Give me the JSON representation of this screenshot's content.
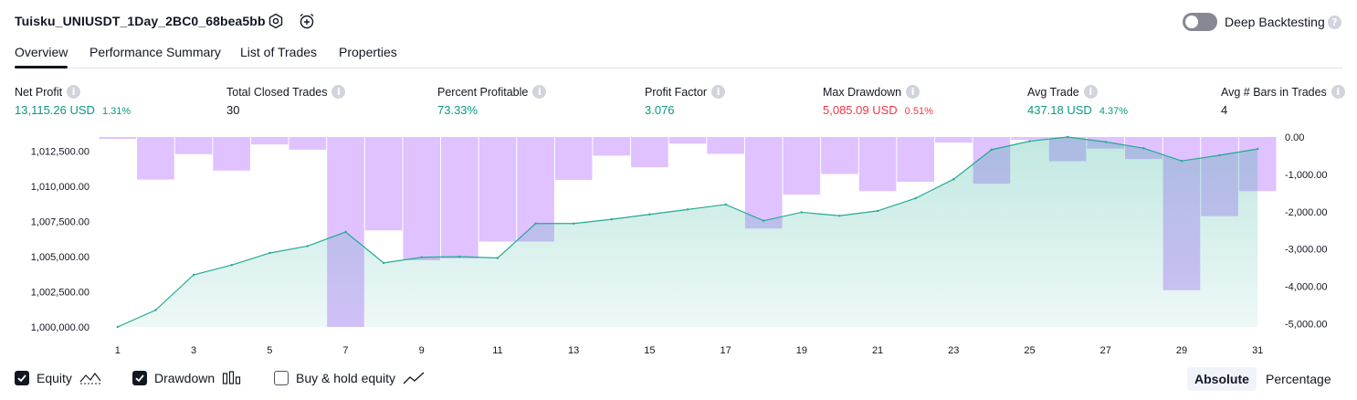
{
  "header": {
    "strategy_title": "Tuisku_UNIUSDT_1Day_2BC0_68bea5bb",
    "settings_icon": "gear-icon",
    "alert_icon": "alarm-clock-plus-icon",
    "deep_backtesting_label": "Deep Backtesting",
    "deep_backtesting_enabled": false
  },
  "tabs": [
    {
      "label": "Overview",
      "active": true
    },
    {
      "label": "Performance Summary",
      "active": false
    },
    {
      "label": "List of Trades",
      "active": false
    },
    {
      "label": "Properties",
      "active": false
    }
  ],
  "metrics": [
    {
      "label": "Net Profit",
      "value": "13,115.26 USD",
      "pct": "1.31%",
      "color": "#089981"
    },
    {
      "label": "Total Closed Trades",
      "value": "30",
      "pct": "",
      "color": "#131722"
    },
    {
      "label": "Percent Profitable",
      "value": "73.33%",
      "pct": "",
      "color": "#089981"
    },
    {
      "label": "Profit Factor",
      "value": "3.076",
      "pct": "",
      "color": "#089981"
    },
    {
      "label": "Max Drawdown",
      "value": "5,085.09 USD",
      "pct": "0.51%",
      "color": "#f23645"
    },
    {
      "label": "Avg Trade",
      "value": "437.18 USD",
      "pct": "4.37%",
      "color": "#089981"
    },
    {
      "label": "Avg # Bars in Trades",
      "value": "4",
      "pct": "",
      "color": "#131722"
    }
  ],
  "chart_data": {
    "type": "line",
    "x": [
      1,
      2,
      3,
      4,
      5,
      6,
      7,
      8,
      9,
      10,
      11,
      12,
      13,
      14,
      15,
      16,
      17,
      18,
      19,
      20,
      21,
      22,
      23,
      24,
      25,
      26,
      27,
      28,
      29,
      30,
      31
    ],
    "xticks": [
      "1",
      "3",
      "5",
      "7",
      "9",
      "11",
      "13",
      "15",
      "17",
      "19",
      "21",
      "23",
      "25",
      "27",
      "29",
      "31"
    ],
    "left_axis": {
      "ticks": [
        "1,012,500.00",
        "1,010,000.00",
        "1,007,500.00",
        "1,005,000.00",
        "1,002,500.00",
        "1,000,000.00"
      ],
      "range": [
        1000000,
        1013500
      ]
    },
    "right_axis": {
      "ticks": [
        "0.00",
        "-1,000.00",
        "-2,000.00",
        "-3,000.00",
        "-4,000.00",
        "-5,000.00"
      ],
      "range": [
        -5085.09,
        0
      ]
    },
    "series": [
      {
        "name": "Equity",
        "axis": "left",
        "type": "area",
        "color": "#22ab94",
        "values": [
          1000000,
          1001200,
          1003700,
          1004400,
          1005250,
          1005750,
          1006750,
          1004550,
          1004950,
          1005000,
          1004900,
          1007350,
          1007350,
          1007650,
          1008000,
          1008350,
          1008700,
          1007550,
          1008150,
          1007900,
          1008250,
          1009150,
          1010500,
          1012600,
          1013200,
          1013500,
          1013150,
          1012700,
          1011800,
          1012200,
          1012650
        ]
      },
      {
        "name": "Drawdown",
        "axis": "right",
        "type": "bar",
        "color": "#c999ff",
        "values": [
          -50,
          -1140,
          -460,
          -900,
          -200,
          -340,
          -5085,
          -2500,
          -3300,
          -3250,
          -2800,
          -2800,
          -1150,
          -500,
          -810,
          -180,
          -450,
          -2450,
          -1540,
          -990,
          -1450,
          -1200,
          -150,
          -1250,
          -80,
          -650,
          -310,
          -590,
          -4100,
          -2120,
          -1450
        ]
      }
    ],
    "grid": false,
    "legend": "bottom-left"
  },
  "legend": [
    {
      "label": "Equity",
      "checked": true,
      "icon": "equity-line-icon"
    },
    {
      "label": "Drawdown",
      "checked": true,
      "icon": "drawdown-bars-icon"
    },
    {
      "label": "Buy & hold equity",
      "checked": false,
      "icon": "buy-hold-line-icon"
    }
  ],
  "view_mode": {
    "absolute_label": "Absolute",
    "percentage_label": "Percentage",
    "selected": "Absolute"
  }
}
